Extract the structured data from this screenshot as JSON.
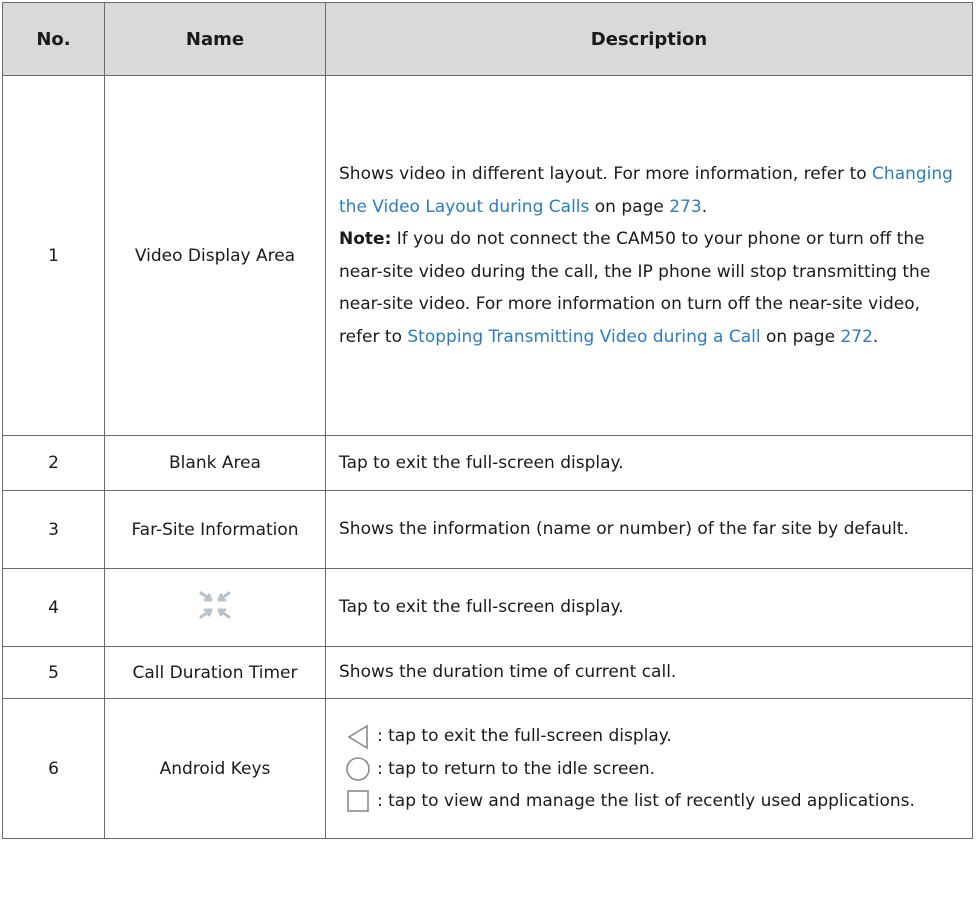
{
  "headers": {
    "no": "No.",
    "name": "Name",
    "description": "Description"
  },
  "rows": [
    {
      "no": "1",
      "name": "Video Display Area",
      "desc": {
        "p1_a": "Shows video in different layout. For more information, refer to ",
        "p1_link": "Changing the Video Layout during Calls",
        "p1_b": " on page ",
        "p1_page": "273",
        "p1_c": ".",
        "note_label": "Note:",
        "note_a": " If you do not connect the CAM50 to your phone or turn off the near-site video during the call, the IP phone will stop transmitting the near-site video. For more information on turn off the near-site video, refer to ",
        "note_link": "Stopping Transmitting Video during a Call",
        "note_b": " on page ",
        "note_page": "272",
        "note_c": "."
      }
    },
    {
      "no": "2",
      "name": "Blank Area",
      "desc": "Tap to exit the full-screen display."
    },
    {
      "no": "3",
      "name": "Far-Site Information",
      "desc": "Shows the information (name or number) of the far site by default."
    },
    {
      "no": "4",
      "name_icon": "exit-fullscreen-icon",
      "desc": "Tap to exit the full-screen display."
    },
    {
      "no": "5",
      "name": "Call Duration Timer",
      "desc": "Shows the duration time of current call."
    },
    {
      "no": "6",
      "name": "Android Keys",
      "keys": [
        {
          "icon": "back-triangle-icon",
          "text": ": tap to exit the full-screen display."
        },
        {
          "icon": "home-circle-icon",
          "text": ": tap to return to the idle screen."
        },
        {
          "icon": "recent-square-icon",
          "text": ": tap to view and manage the list of recently used applications."
        }
      ]
    }
  ]
}
